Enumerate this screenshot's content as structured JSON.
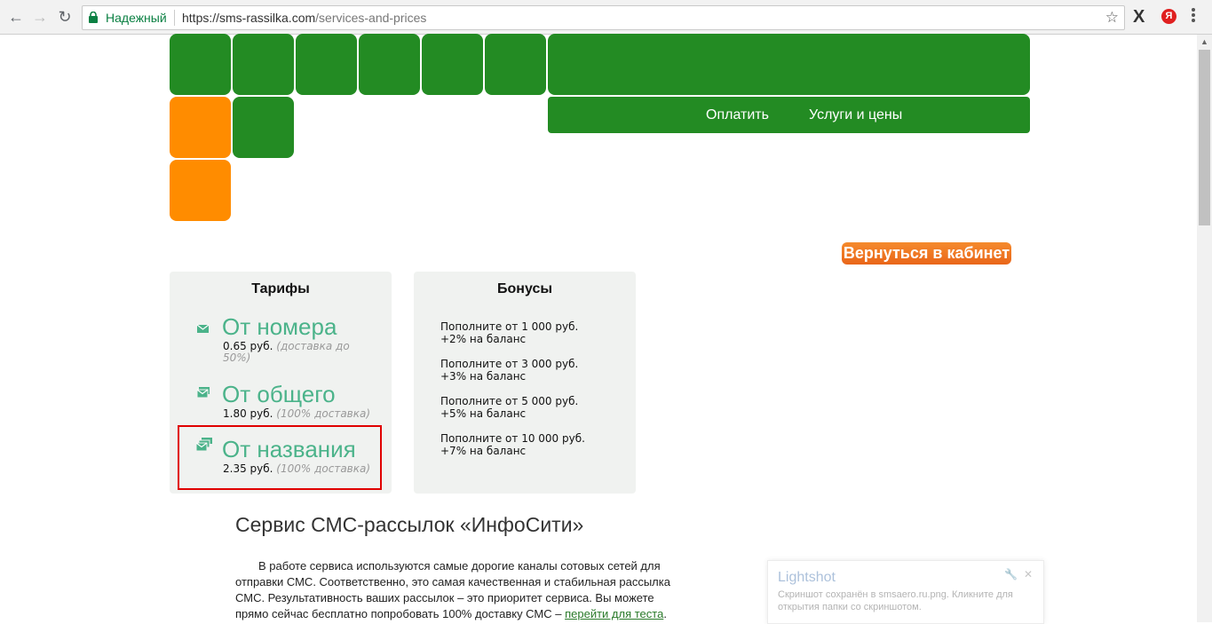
{
  "browser": {
    "secure_label": "Надежный",
    "url_host": "https://sms-rassilka.com",
    "url_path": "/services-and-prices",
    "ext_x": "X",
    "ext_ya": "Я"
  },
  "menu": {
    "pay": "Оплатить",
    "services": "Услуги и цены"
  },
  "back_button": "Вернуться в кабинет",
  "tariffs": {
    "title": "Тарифы",
    "items": [
      {
        "name": "От номера",
        "price": "0.65 руб.",
        "note": "(доставка до 50%)"
      },
      {
        "name": "От общего",
        "price": "1.80 руб.",
        "note": "(100% доставка)"
      },
      {
        "name": "От названия",
        "price": "2.35 руб.",
        "note": "(100% доставка)"
      }
    ]
  },
  "bonuses": {
    "title": "Бонусы",
    "items": [
      {
        "line1": "Пополните от 1 000 руб.",
        "line2": "+2% на баланс"
      },
      {
        "line1": "Пополните от 3 000 руб.",
        "line2": "+3% на баланс"
      },
      {
        "line1": "Пополните от 5 000 руб.",
        "line2": "+5% на баланс"
      },
      {
        "line1": "Пополните от 10 000 руб.",
        "line2": "+7% на баланс"
      }
    ]
  },
  "article": {
    "heading": "Сервис СМС-рассылок «ИнфоСити»",
    "text": "В работе сервиса используются самые дорогие каналы сотовых сетей для отправки СМС. Соответственно, это самая качественная и стабильная рассылка СМС. Результативность ваших рассылок – это приоритет сервиса. Вы можете прямо сейчас бесплатно попробовать 100% доставку СМС – ",
    "link": "перейти для теста",
    "end": "."
  },
  "lightshot": {
    "title": "Lightshot",
    "body": "Скриншот сохранён в smsaero.ru.png. Кликните для открытия папки со скриншотом."
  },
  "colors": {
    "tile_green": "#238b23",
    "tile_orange": "#ff8c00",
    "tariff_text": "#4bb38a",
    "highlight": "#e00000"
  }
}
